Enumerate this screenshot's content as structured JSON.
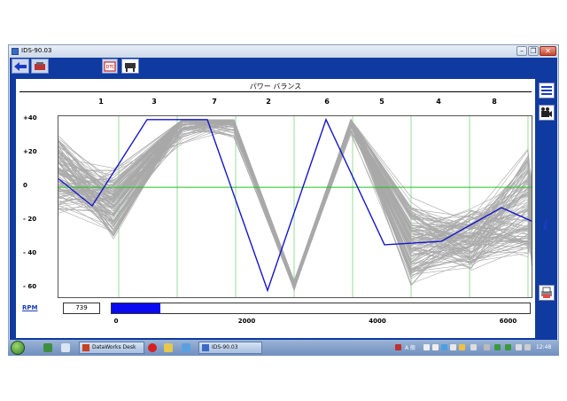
{
  "window": {
    "title": "IDS-90.03",
    "min_label": "–",
    "max_label": "❐",
    "close_label": "✕"
  },
  "panel": {
    "title": "パワー バランス"
  },
  "columns": [
    "1",
    "3",
    "7",
    "2",
    "6",
    "5",
    "4",
    "8"
  ],
  "chart_data": {
    "type": "line",
    "title": "パワー バランス",
    "categories": [
      "1",
      "3",
      "7",
      "2",
      "6",
      "5",
      "4",
      "8"
    ],
    "y_ticks": [
      "+40",
      "+20",
      "0",
      "- 20",
      "- 40",
      "- 60"
    ],
    "ylim": [
      -65,
      42
    ],
    "series": [
      {
        "color": "#1616c8",
        "values": [
          5,
          -11,
          40,
          40,
          -61,
          40,
          -34,
          -32,
          -12,
          -20
        ]
      }
    ],
    "background_series_color": "#a9a9a9",
    "zero_line_color": "#22c022",
    "grid": true
  },
  "rpm": {
    "label": "RPM",
    "value": "739",
    "max": 6400,
    "ticks": [
      "0",
      "2000",
      "4000",
      "6000"
    ],
    "bar_color": "#0a0af0"
  },
  "taskbar": {
    "items": [
      "DataWorks Desk",
      "IDS-90.03"
    ],
    "clock": "12:48",
    "ime": "A 般"
  },
  "icons": {
    "toolbar": [
      "back-arrow-icon",
      "ecu-icon",
      "dtc-icon",
      "vehicle-lift-icon"
    ],
    "side": [
      "list-icon",
      "camera-icon",
      "info-icon",
      "print-icon"
    ],
    "bottom": [
      "grid-icon",
      "table-icon",
      "bars-icon",
      "status-icon",
      "battery-icon"
    ]
  }
}
